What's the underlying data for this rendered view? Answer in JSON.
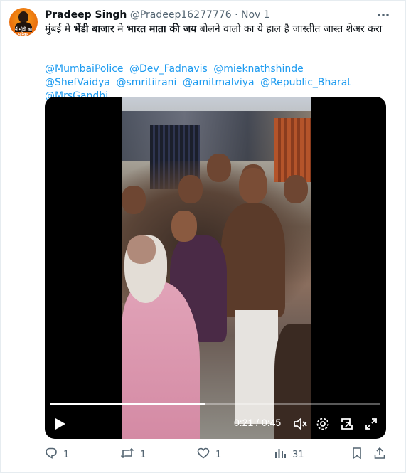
{
  "tweet": {
    "author_name": "Pradeep Singh",
    "author_handle": "@Pradeep16277776",
    "separator": "·",
    "date": "Nov 1",
    "avatar_text": "मैं मोदी का परिवार",
    "text_part1": "मुंबई मे ",
    "text_bold1": "भेंडी बाजार",
    "text_part2": " मे ",
    "text_bold2": "भारत माता की जय",
    "text_part3": " बोलने वालो का ये हाल है जास्तीत जास्त शेअर करा",
    "mentions": [
      "@MumbaiPolice",
      "@Dev_Fadnavis",
      "@mieknathshinde",
      "@ShefVaidya",
      "@smritiirani",
      "@amitmalviya",
      "@Republic_Bharat",
      "@MrsGandhi"
    ]
  },
  "video": {
    "current_time": "0:21",
    "time_separator": "/",
    "duration": "0:45",
    "progress_fraction": 0.467
  },
  "actions": {
    "replies": "1",
    "retweets": "1",
    "likes": "1",
    "views": "31"
  },
  "colors": {
    "link": "#1d9bf0",
    "muted": "#536471",
    "text": "#0f1419"
  },
  "icons": [
    "more-icon",
    "play-icon",
    "settings-icon",
    "volume-icon",
    "exit-fullscreen-icon",
    "fullscreen-icon",
    "reply-icon",
    "retweet-icon",
    "like-icon",
    "views-icon",
    "bookmark-icon",
    "share-icon"
  ]
}
